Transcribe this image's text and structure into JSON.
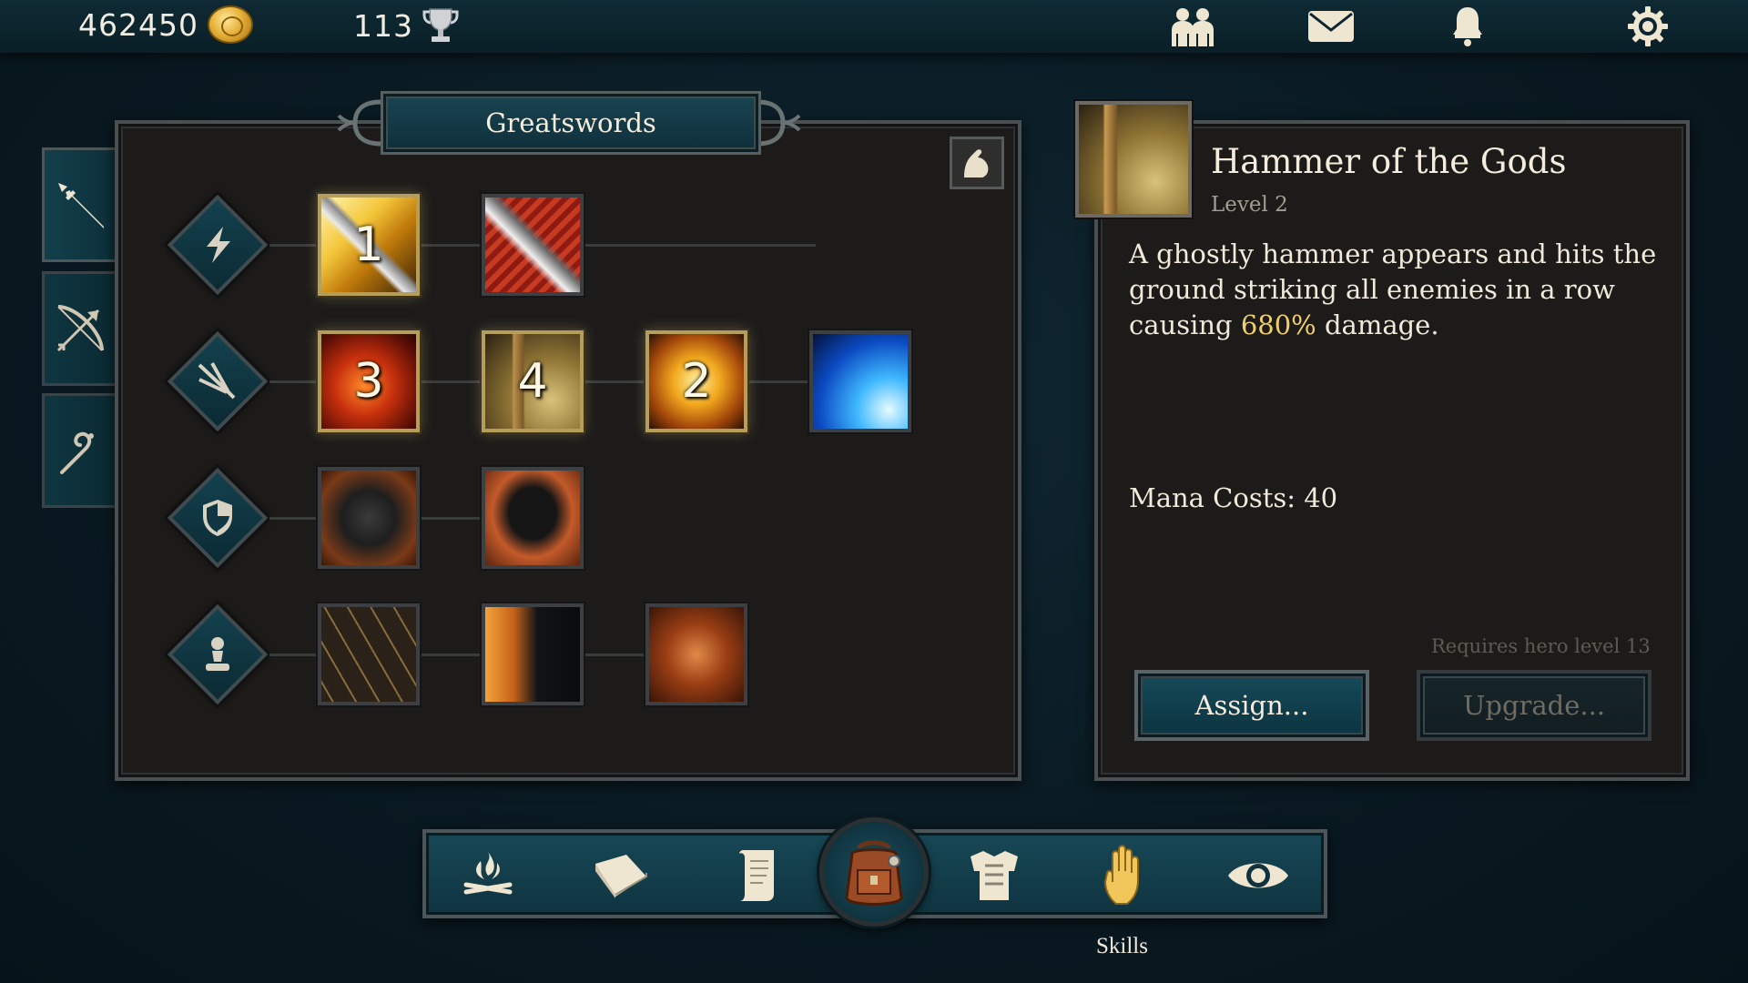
{
  "currency": {
    "gold": "462450",
    "trophies": "113"
  },
  "top_icons": [
    "friends-icon",
    "mail-icon",
    "bell-icon",
    "gear-icon"
  ],
  "categories": [
    {
      "id": "melee",
      "icon": "sword-icon",
      "active": true
    },
    {
      "id": "ranged",
      "icon": "bow-icon",
      "active": false
    },
    {
      "id": "magic",
      "icon": "staff-icon",
      "active": false
    }
  ],
  "tree": {
    "title": "Greatswords",
    "rows": [
      {
        "icon": "lightning-icon",
        "skills": [
          {
            "art": "golden-slash",
            "level": "1",
            "learned": true
          },
          {
            "art": "red-blade",
            "level": "",
            "learned": false
          }
        ]
      },
      {
        "icon": "arrow-burst-icon",
        "skills": [
          {
            "art": "fire-swirl",
            "level": "3",
            "learned": true
          },
          {
            "art": "hammer",
            "level": "4",
            "learned": true
          },
          {
            "art": "golden-whirl",
            "level": "2",
            "learned": true
          },
          {
            "art": "ice-burst",
            "level": "",
            "learned": false
          }
        ]
      },
      {
        "icon": "shield-icon",
        "skills": [
          {
            "art": "iron-shield",
            "level": "",
            "learned": false
          },
          {
            "art": "dark-shield",
            "level": "",
            "learned": false
          }
        ]
      },
      {
        "icon": "pawn-icon",
        "skills": [
          {
            "art": "cracked-earth",
            "level": "",
            "learned": false
          },
          {
            "art": "lion-roar",
            "level": "",
            "learned": false
          },
          {
            "art": "flaming-boot",
            "level": "",
            "learned": false
          }
        ]
      }
    ]
  },
  "detail": {
    "name": "Hammer of the Gods",
    "level": "Level 2",
    "desc_before": "A ghostly hammer appears and hits the ground striking all enemies in a row causing ",
    "desc_highlight": "680%",
    "desc_after": " damage.",
    "mana": "Mana Costs: 40",
    "requirement": "Requires hero level 13",
    "assign_label": "Assign...",
    "upgrade_label": "Upgrade..."
  },
  "nav": {
    "items": [
      "campfire-icon",
      "book-icon",
      "scroll-icon",
      "backpack-icon",
      "armor-icon",
      "hand-icon",
      "eye-icon"
    ],
    "active_label": "Skills"
  },
  "colors": {
    "highlight": "#f0cf6a",
    "panel": "#1c1b1a",
    "teal": "#0f3440",
    "learned_border": "#b59d5a"
  }
}
